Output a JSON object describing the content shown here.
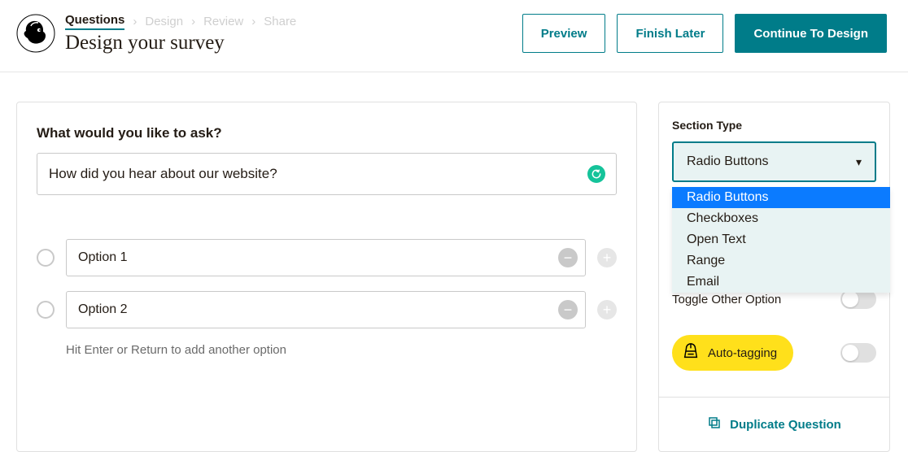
{
  "header": {
    "breadcrumbs": {
      "active": "Questions",
      "step2": "Design",
      "step3": "Review",
      "step4": "Share"
    },
    "title": "Design your survey",
    "buttons": {
      "preview": "Preview",
      "finish_later": "Finish Later",
      "continue": "Continue To Design"
    }
  },
  "main": {
    "prompt_label": "What would you like to ask?",
    "question_value": "How did you hear about our website?",
    "options": [
      {
        "value": "Option 1"
      },
      {
        "value": "Option 2"
      }
    ],
    "hint": "Hit Enter or Return to add another option",
    "minus": "−",
    "plus": "+"
  },
  "sidebar": {
    "section_type_label": "Section Type",
    "selected": "Radio Buttons",
    "dropdown": {
      "item0": "Radio Buttons",
      "item1": "Checkboxes",
      "item2": "Open Text",
      "item3": "Range",
      "item4": "Email"
    },
    "toggle_other_label": "Toggle Other Option",
    "autotag_label": "Auto-tagging",
    "duplicate_label": "Duplicate Question"
  }
}
